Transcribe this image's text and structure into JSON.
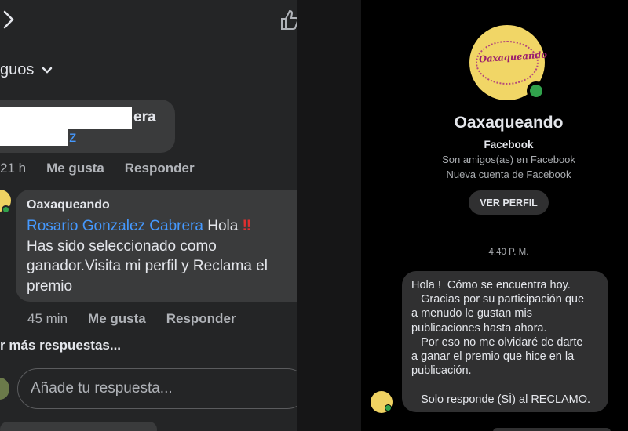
{
  "left": {
    "sort_label": "guos",
    "comment1": {
      "tail_line1": "era",
      "tail_line2": "z",
      "time": "21 h",
      "like": "Me gusta",
      "reply": "Responder"
    },
    "comment2": {
      "author": "Oaxaqueando",
      "mention": "Rosario Gonzalez Cabrera",
      "text_after_mention": " Hola ",
      "alert": "‼",
      "text_rest": "Has sido seleccionado como ganador.Visita mi perfil y Reclama el premio",
      "time": "45 min",
      "like": "Me gusta",
      "reply": "Responder"
    },
    "more_replies": "r más respuestas...",
    "reply_placeholder": "Añade tu respuesta..."
  },
  "right": {
    "logo_text": "Oaxaqueando",
    "profile_name": "Oaxaqueando",
    "platform": "Facebook",
    "friends_note": "Son amigos(as) en Facebook",
    "new_account_note": "Nueva cuenta de Facebook",
    "view_profile": "VER PERFIL",
    "timestamp": "4:40 P. M.",
    "message_lines": [
      "Hola !  Cómo se encuentra hoy.",
      "   Gracias por su participación que",
      "a menudo le gustan mis",
      "publicaciones hasta ahora.",
      "   Por eso no me olvidaré de darte",
      "a ganar el premio que hice en la",
      "publicación.",
      "",
      "   Solo responde (SÍ) al RECLAMO."
    ]
  }
}
